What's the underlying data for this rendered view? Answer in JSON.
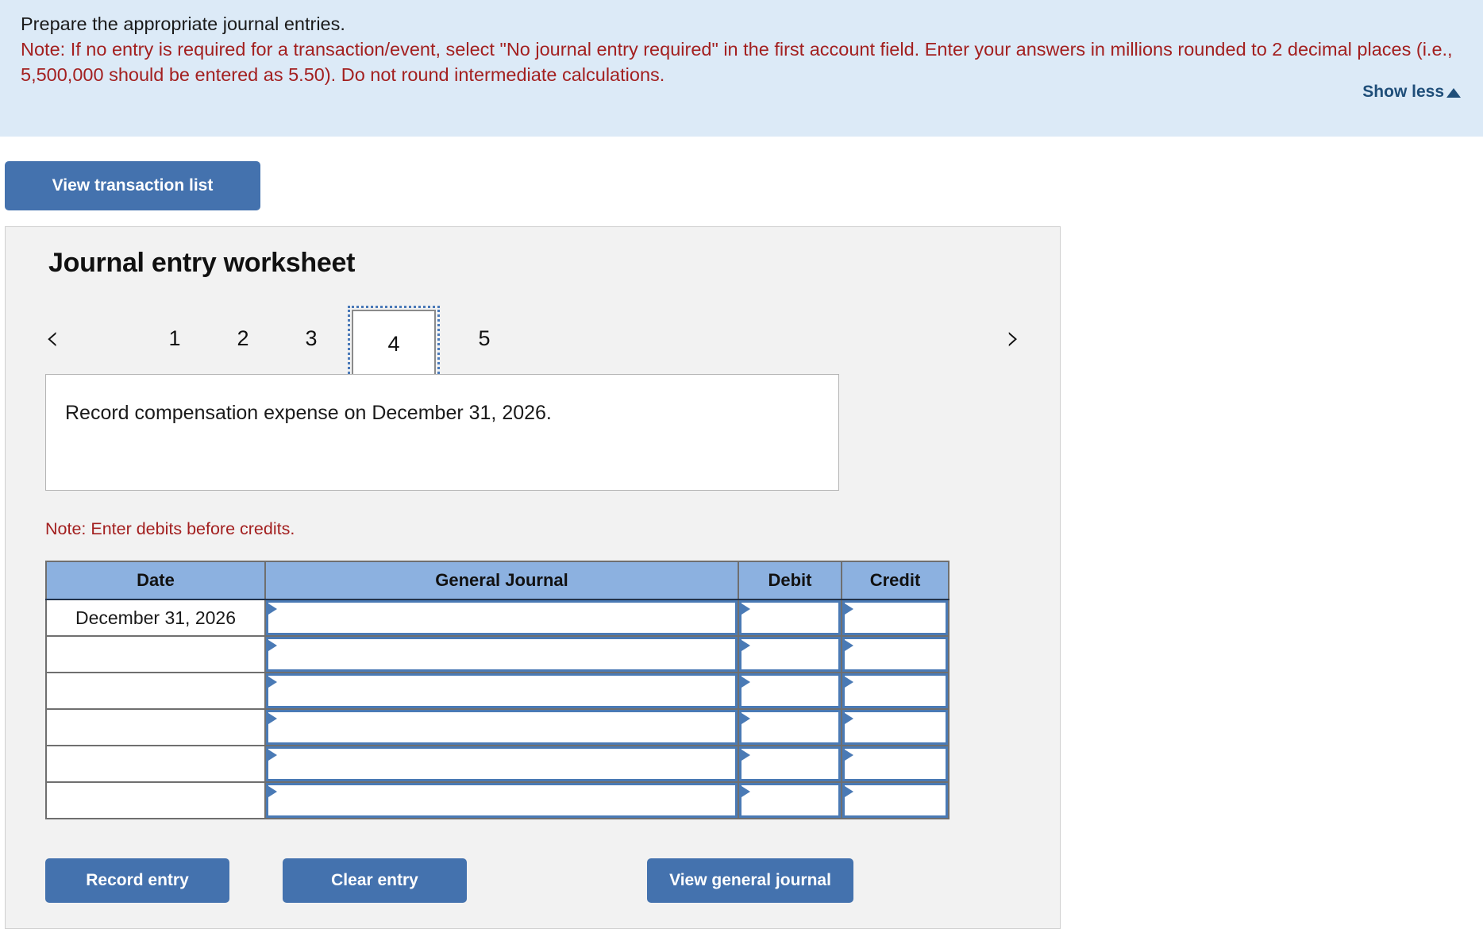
{
  "info": {
    "prompt": "Prepare the appropriate journal entries.",
    "note": "Note: If no entry is required for a transaction/event, select \"No journal entry required\" in the first account field. Enter your answers in millions rounded to 2 decimal places (i.e., 5,500,000 should be entered as 5.50). Do not round intermediate calculations.",
    "show_less_label": "Show less",
    "caret_icon": "triangle-up-icon",
    "background_color": "#dceaf7",
    "note_color": "#a32020",
    "link_color": "#1f4e79"
  },
  "toolbar": {
    "view_transaction_list_label": "View transaction list"
  },
  "worksheet": {
    "title": "Journal entry worksheet",
    "pager": {
      "prev_icon": "chevron-left-icon",
      "next_icon": "chevron-right-icon",
      "prev_glyph": "‹",
      "next_glyph": "›",
      "pages": [
        "1",
        "2",
        "3",
        "4",
        "5"
      ],
      "active_page": "4"
    },
    "description": "Record compensation expense on December 31, 2026.",
    "debit_note": "Note: Enter debits before credits.",
    "table": {
      "headers": [
        "Date",
        "General Journal",
        "Debit",
        "Credit"
      ],
      "rows": [
        {
          "date": "December 31, 2026",
          "general_journal": "",
          "debit": "",
          "credit": ""
        },
        {
          "date": "",
          "general_journal": "",
          "debit": "",
          "credit": ""
        },
        {
          "date": "",
          "general_journal": "",
          "debit": "",
          "credit": ""
        },
        {
          "date": "",
          "general_journal": "",
          "debit": "",
          "credit": ""
        },
        {
          "date": "",
          "general_journal": "",
          "debit": "",
          "credit": ""
        },
        {
          "date": "",
          "general_journal": "",
          "debit": "",
          "credit": ""
        }
      ],
      "header_color": "#8cb1e0",
      "input_border_color": "#4a7ab5"
    },
    "actions": {
      "record_entry_label": "Record entry",
      "clear_entry_label": "Clear entry",
      "view_general_journal_label": "View general journal"
    },
    "button_color": "#4472ae"
  }
}
